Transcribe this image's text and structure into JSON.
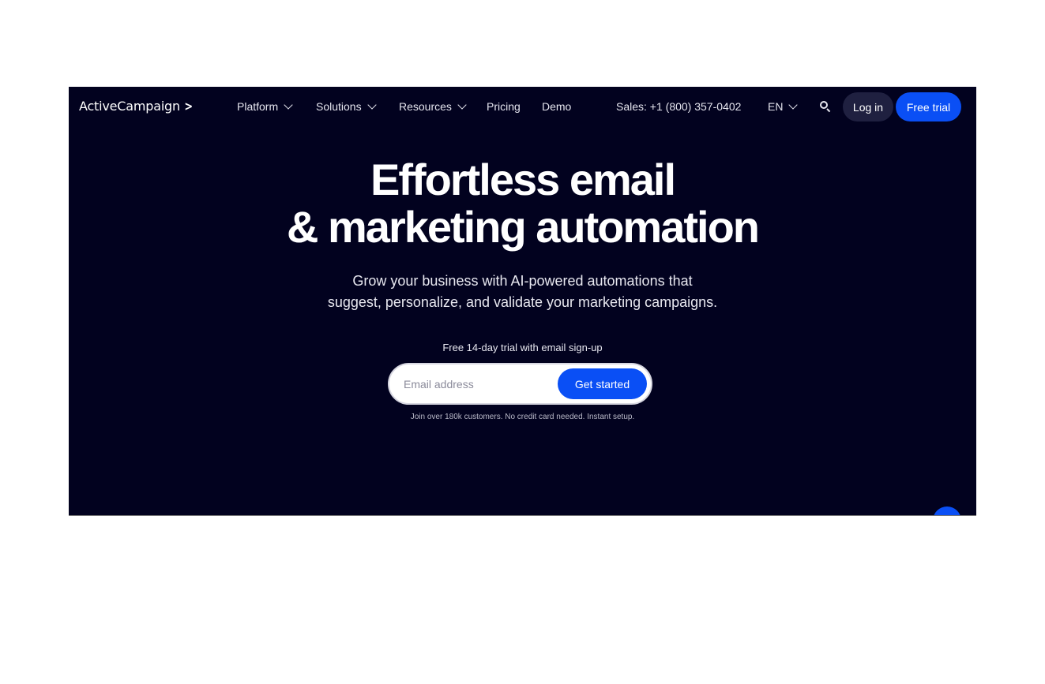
{
  "nav": {
    "logo": "ActiveCampaign",
    "logo_glyph": ">",
    "items": [
      {
        "label": "Platform",
        "has_dropdown": true
      },
      {
        "label": "Solutions",
        "has_dropdown": true
      },
      {
        "label": "Resources",
        "has_dropdown": true
      },
      {
        "label": "Pricing",
        "has_dropdown": false
      },
      {
        "label": "Demo",
        "has_dropdown": false
      }
    ],
    "sales": "Sales: +1 (800) 357-0402",
    "language": "EN",
    "search_icon": "search-icon",
    "login_label": "Log in",
    "trial_label": "Free trial"
  },
  "hero": {
    "title_line1": "Effortless email",
    "title_line2": "& marketing automation",
    "subtitle_line1": "Grow your business with AI-powered automations that",
    "subtitle_line2": "suggest, personalize, and validate your marketing campaigns.",
    "trial_note": "Free 14-day trial with email sign-up",
    "email_placeholder": "Email address",
    "email_value": "",
    "cta_label": "Get started",
    "disclaimer": "Join over 180k customers. No credit card needed. Instant setup."
  },
  "colors": {
    "background": "#02021f",
    "accent": "#0a4ff5",
    "login_bg": "#1f2040"
  }
}
